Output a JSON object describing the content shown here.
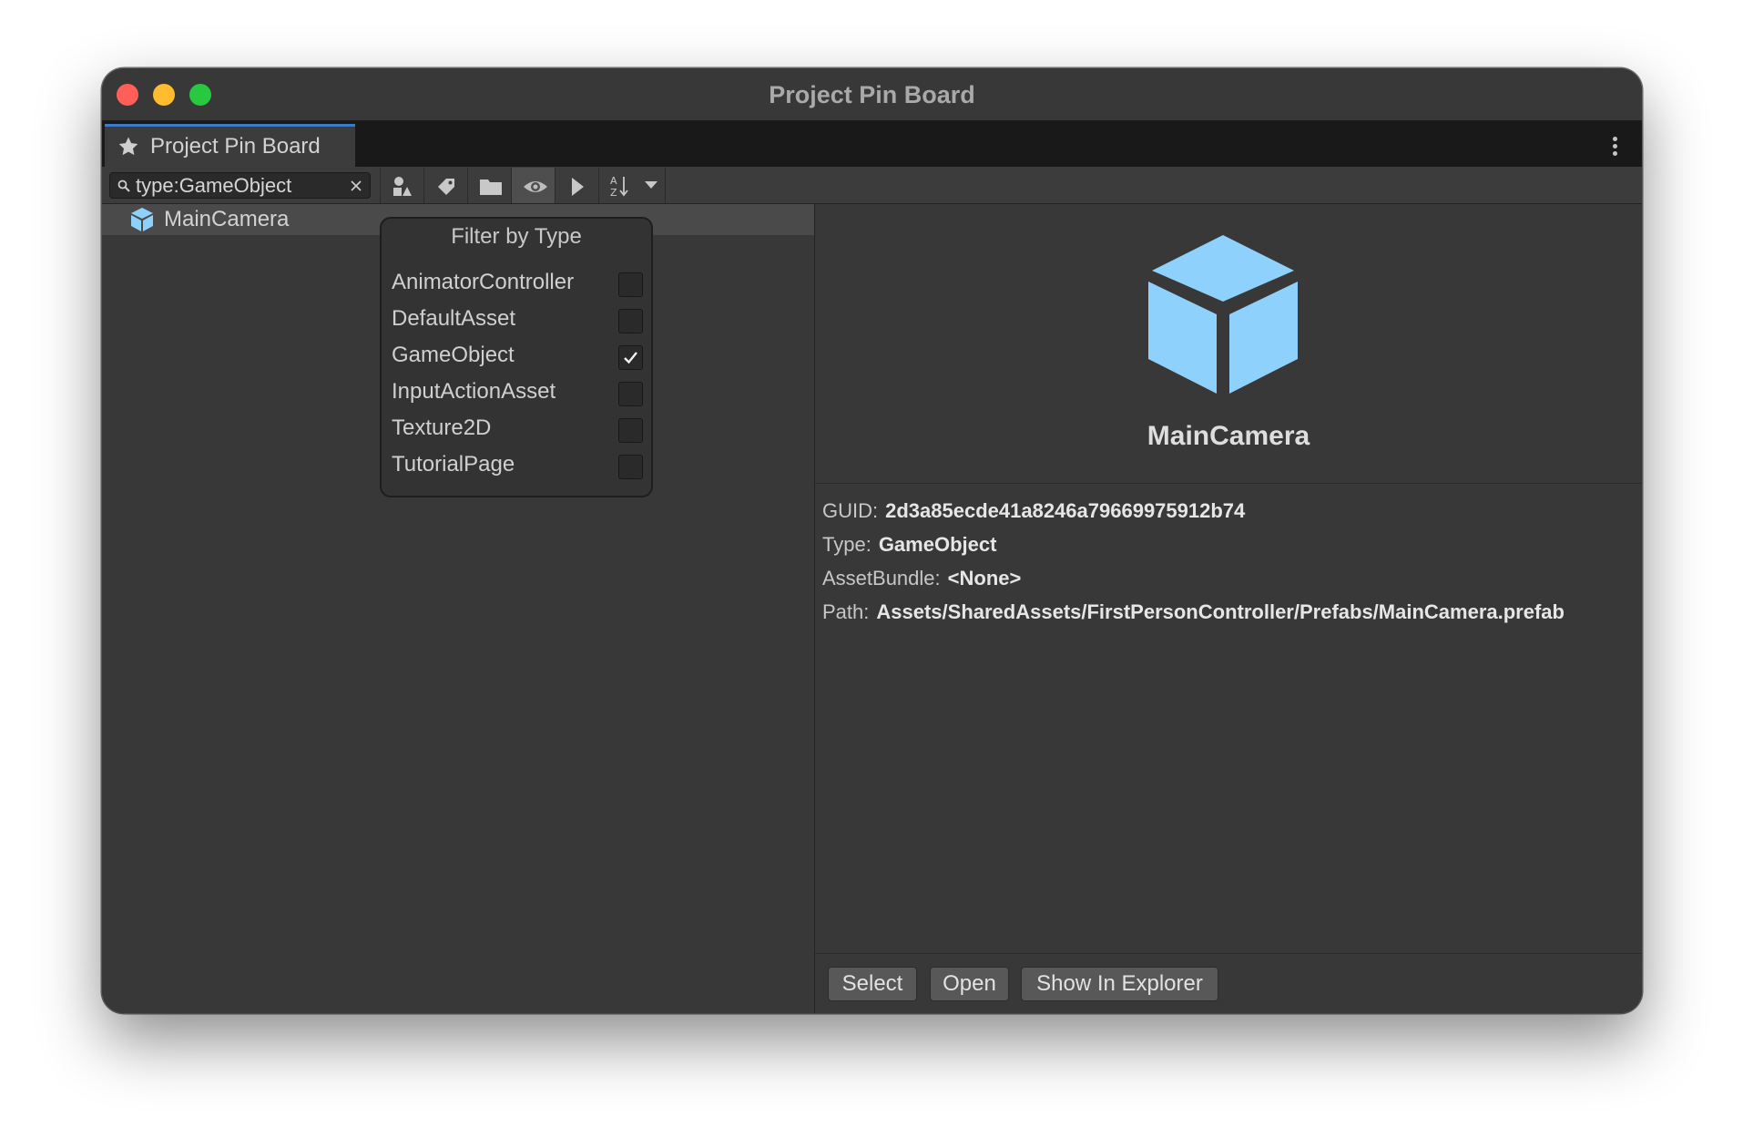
{
  "window": {
    "title": "Project Pin Board"
  },
  "tab": {
    "label": "Project Pin Board",
    "icon": "star-icon"
  },
  "toolbar": {
    "search_value": "type:GameObject",
    "icons": [
      "search-icon",
      "clear-icon",
      "filter-type-icon",
      "filter-label-icon",
      "filter-folder-icon",
      "visibility-eye-icon",
      "select-pointer-icon",
      "sort-az-icon",
      "dropdown-arrow-icon"
    ]
  },
  "list": {
    "items": [
      {
        "name": "MainCamera",
        "icon": "prefab-cube-icon"
      }
    ]
  },
  "filter_popup": {
    "title": "Filter by Type",
    "items": [
      {
        "label": "AnimatorController",
        "checked": false
      },
      {
        "label": "DefaultAsset",
        "checked": false
      },
      {
        "label": "GameObject",
        "checked": true
      },
      {
        "label": "InputActionAsset",
        "checked": false
      },
      {
        "label": "Texture2D",
        "checked": false
      },
      {
        "label": "TutorialPage",
        "checked": false
      }
    ]
  },
  "details": {
    "name": "MainCamera",
    "props": [
      {
        "key": "GUID:",
        "value": "2d3a85ecde41a8246a79669975912b74"
      },
      {
        "key": "Type:",
        "value": "GameObject"
      },
      {
        "key": "AssetBundle:",
        "value": "<None>"
      },
      {
        "key": "Path:",
        "value": "Assets/SharedAssets/FirstPersonController/Prefabs/MainCamera.prefab"
      }
    ]
  },
  "buttons": {
    "select": "Select",
    "open": "Open",
    "show_in_explorer": "Show In Explorer"
  },
  "colors": {
    "accent": "#3a7bc8",
    "cube": "#8ed1fc",
    "background": "#383838"
  }
}
